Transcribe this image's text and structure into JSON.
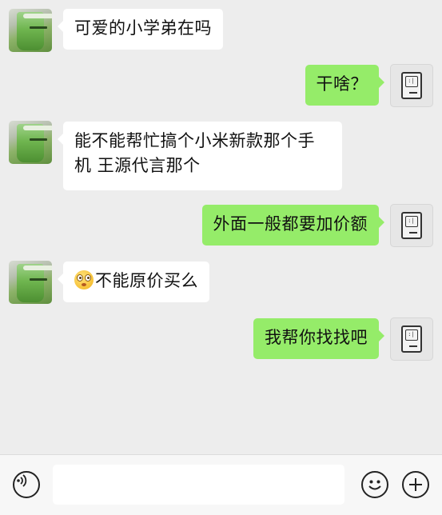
{
  "messages": [
    {
      "side": "left",
      "text": "可爱的小学弟在吗"
    },
    {
      "side": "right",
      "text": "干啥？"
    },
    {
      "side": "left",
      "text_line1": "能不能帮忙搞个小米新款那个手",
      "text_line2": "机 王源代言那个"
    },
    {
      "side": "right",
      "text": "外面一般都要加价额"
    },
    {
      "side": "left",
      "emoji": "flushed-face",
      "text": "不能原价买么"
    },
    {
      "side": "right",
      "text": "我帮你找找吧"
    }
  ],
  "input_bar": {
    "text_value": "",
    "icons": [
      "voice-icon",
      "emoji-icon",
      "plus-icon"
    ]
  },
  "colors": {
    "background": "#ededed",
    "sent_bubble": "#95ec69",
    "received_bubble": "#ffffff",
    "input_bar": "#f7f7f7"
  }
}
